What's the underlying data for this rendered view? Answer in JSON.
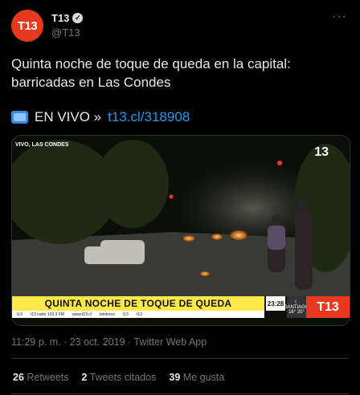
{
  "author": {
    "avatar_text": "T13",
    "name": "T13",
    "handle": "@T13",
    "verified_icon": "verified-badge-icon"
  },
  "more_icon": "more-options-icon",
  "tweet": {
    "text": "Quinta noche de toque de queda en la capital: barricadas en Las Condes",
    "live_label": "EN VIVO »",
    "link": "t13.cl/318908"
  },
  "media": {
    "top_ticker": "VIVO, LAS CONDES",
    "corner_logo": "13",
    "banner": "QUINTA NOCHE DE TOQUE DE QUEDA",
    "subbar": [
      "t13",
      "t13 radio 103.3 FM",
      "www.t13.cl",
      "teletrece",
      "t13",
      "t13"
    ],
    "clock": "23:28",
    "weather_city": "SANTIAGO",
    "weather_temps": "16° 20°",
    "brand": "T13"
  },
  "meta": "11:29 p. m. · 23 oct. 2019 · Twitter Web App",
  "stats": {
    "retweets_count": "26",
    "retweets_label": "Retweets",
    "quotes_count": "2",
    "quotes_label": "Tweets citados",
    "likes_count": "39",
    "likes_label": "Me gusta"
  },
  "colors": {
    "brand": "#e8391e",
    "link": "#1d9bf0",
    "banner": "#ffe94a"
  }
}
